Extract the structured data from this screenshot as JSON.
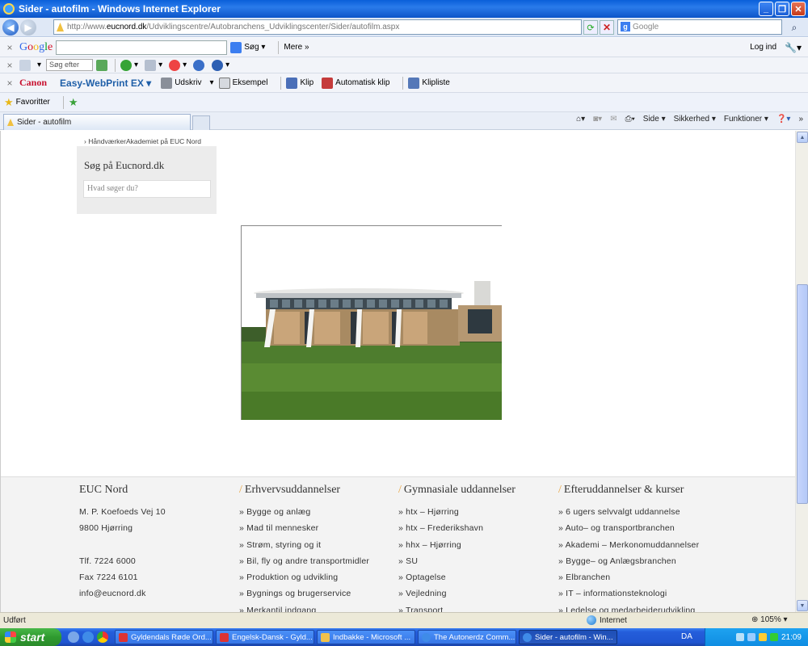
{
  "window": {
    "title": "Sider - autofilm - Windows Internet Explorer"
  },
  "address": {
    "url_prefix": "http://www.",
    "url_domain": "eucnord.dk",
    "url_path": "/Udviklingscentre/Autobranchens_Udviklingscenter/Sider/autofilm.aspx",
    "search_placeholder": "Google"
  },
  "google_toolbar": {
    "logo": "Google",
    "search_label": "Søg",
    "more_label": "Mere",
    "login_label": "Log ind"
  },
  "second_toolbar": {
    "search_placeholder": "Søg efter søg"
  },
  "canon_toolbar": {
    "canon_label": "Canon",
    "ewp_label": "Easy-WebPrint EX",
    "items": [
      "Udskriv",
      "Eksempel",
      "Klip",
      "Automatisk klip",
      "Klipliste"
    ]
  },
  "favorites": {
    "label": "Favoritter"
  },
  "tab": {
    "label": "Sider - autofilm"
  },
  "commandbar": {
    "side": "Side",
    "sikkerhed": "Sikkerhed",
    "funktioner": "Funktioner"
  },
  "page": {
    "breadcrumb": "› HåndværkerAkademiet på EUC Nord",
    "search_title": "Søg på Eucnord.dk",
    "search_placeholder": "Hvad søger du?"
  },
  "footer": {
    "contact": {
      "title": "EUC Nord",
      "lines": [
        "M. P. Koefoeds Vej 10",
        "9800 Hjørring",
        "",
        "Tlf. 7224 6000",
        "Fax 7224 6101",
        "info@eucnord.dk"
      ]
    },
    "erhverv": {
      "title": "Erhvervsuddannelser",
      "items": [
        "» Bygge og anlæg",
        "» Mad til mennesker",
        "» Strøm, styring og it",
        "» Bil, fly og andre transportmidler",
        "» Produktion og udvikling",
        "» Bygnings og brugerservice",
        "» Merkantil indgang"
      ]
    },
    "gymnasial": {
      "title": "Gymnasiale uddannelser",
      "items": [
        "» htx – Hjørring",
        "» htx – Frederikshavn",
        "» hhx – Hjørring",
        "» SU",
        "» Optagelse",
        "» Vejledning",
        "» Transport"
      ]
    },
    "efter": {
      "title": "Efteruddannelser & kurser",
      "items": [
        "» 6 ugers selvvalgt uddannelse",
        "» Auto– og transportbranchen",
        "» Akademi – Merkonomuddannelser",
        "» Bygge– og Anlægsbranchen",
        "» Elbranchen",
        "» IT – informationsteknologi",
        "» Ledelse og medarbejderudvikling"
      ]
    }
  },
  "statusbar": {
    "status": "Udført",
    "zone": "Internet",
    "zoom": "105%"
  },
  "taskbar": {
    "start": "start",
    "tasks": [
      "Gyldendals Røde Ord...",
      "Engelsk-Dansk - Gyld...",
      "Indbakke - Microsoft ...",
      "The Autonerdz Comm...",
      "Sider - autofilm - Win..."
    ],
    "lang": "DA",
    "clock": "21:09"
  },
  "colors": {
    "accent_orange": "#e8a33d",
    "title_blue": "#0a5fd9",
    "footer_bg": "#f3f3f3"
  }
}
